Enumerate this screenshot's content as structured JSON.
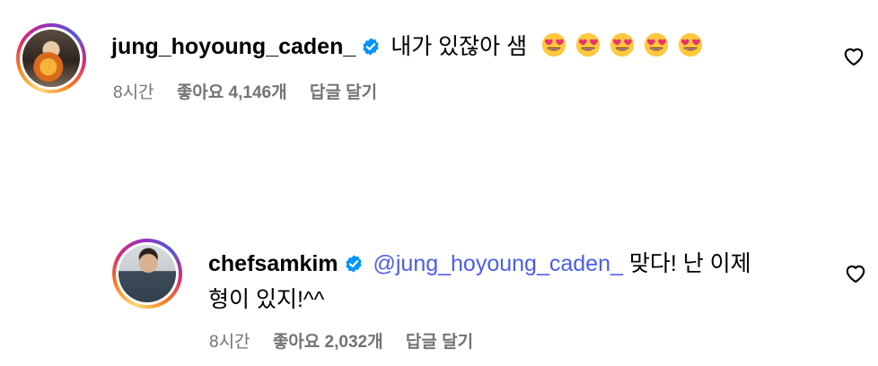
{
  "comments": [
    {
      "username": "jung_hoyoung_caden_",
      "text": "내가 있잖아 샘",
      "emoji_count": 5,
      "time": "8시간",
      "likes": "좋아요 4,146개",
      "reply": "답글 달기"
    },
    {
      "username": "chefsamkim",
      "mention": "@jung_hoyoung_caden_",
      "text_line1": "맞다! 난 이제",
      "text_line2": "형이 있지!^^",
      "time": "8시간",
      "likes": "좋아요 2,032개",
      "reply": "답글 달기"
    }
  ],
  "colors": {
    "verified": "#0095f6",
    "mention": "#4a5dea",
    "meta": "#737373"
  },
  "icons": {
    "verified": "verified-badge-icon",
    "like": "heart-outline-icon",
    "emoji": "heart-eyes-emoji"
  }
}
